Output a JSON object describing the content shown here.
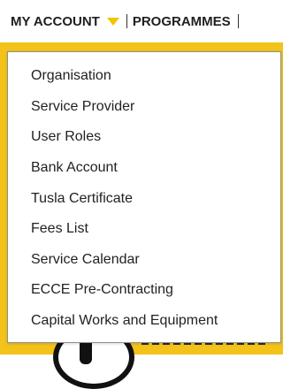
{
  "nav": {
    "my_account": "MY ACCOUNT",
    "programmes": "PROGRAMMES"
  },
  "menu": {
    "items": [
      "Organisation",
      "Service Provider",
      "User Roles",
      "Bank Account",
      "Tusla Certificate",
      "Fees List",
      "Service Calendar",
      "ECCE Pre-Contracting",
      "Capital Works and Equipment"
    ]
  },
  "colors": {
    "accent": "#f2c400",
    "text": "#222222",
    "border": "#8f8f8f"
  }
}
